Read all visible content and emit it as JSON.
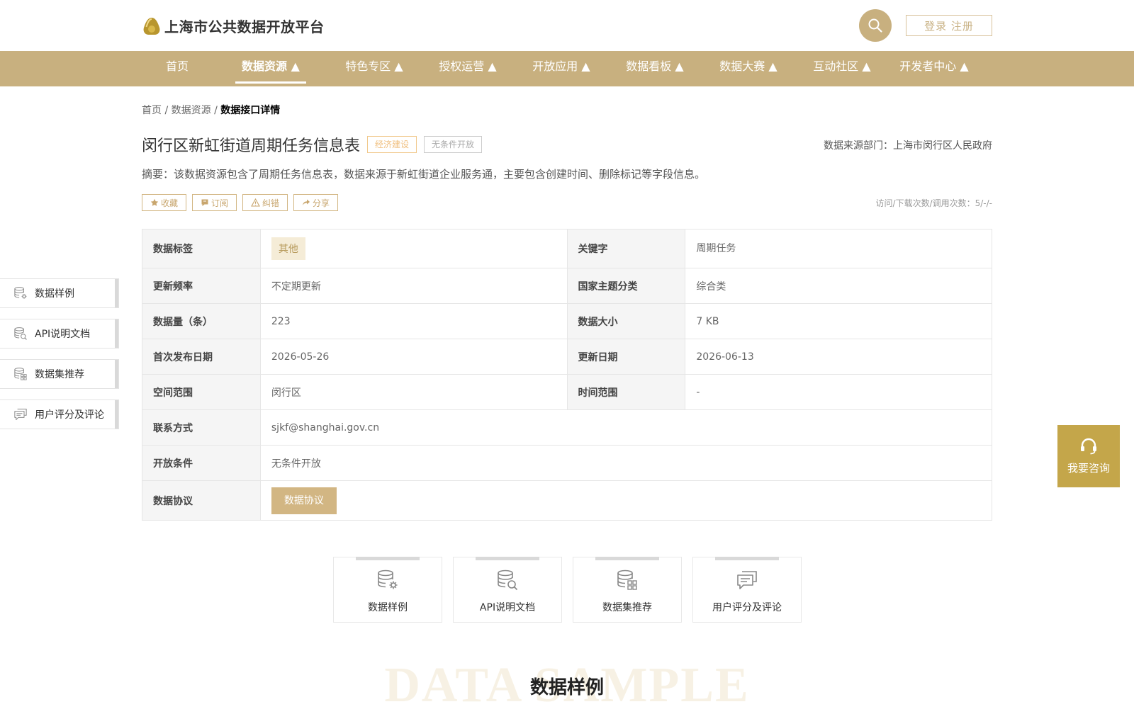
{
  "header": {
    "title": "上海市公共数据开放平台",
    "login_label": "登录 注册"
  },
  "nav": {
    "items": [
      {
        "label": "首页"
      },
      {
        "label": "数据资源 ▲"
      },
      {
        "label": "特色专区 ▲"
      },
      {
        "label": "授权运营 ▲"
      },
      {
        "label": "开放应用 ▲"
      },
      {
        "label": "数据看板 ▲"
      },
      {
        "label": "数据大赛 ▲"
      },
      {
        "label": "互动社区 ▲"
      },
      {
        "label": "开发者中心 ▲"
      }
    ],
    "active_index": 1
  },
  "breadcrumb": {
    "home": "首页",
    "sep": " / ",
    "resources": "数据资源",
    "current": "数据接口详情"
  },
  "detail": {
    "title": "闵行区新虹街道周期任务信息表",
    "tag_category": "经济建设",
    "tag_open": "无条件开放",
    "source": "数据来源部门：上海市闵行区人民政府",
    "summary": "摘要：该数据资源包含了周期任务信息表，数据来源于新虹街道企业服务通，主要包含创建时间、删除标记等字段信息。",
    "actions": {
      "collect": "收藏",
      "subscribe": "订阅",
      "report": "纠错",
      "share": "分享"
    },
    "stats": "访问/下载次数/调用次数：5/-/-"
  },
  "info": {
    "data_tag_label": "数据标签",
    "data_tag_value": "其他",
    "keyword_label": "关键字",
    "keyword_value": "周期任务",
    "freq_label": "更新频率",
    "freq_value": "不定期更新",
    "theme_label": "国家主题分类",
    "theme_value": "综合类",
    "count_label": "数据量（条）",
    "count_value": "223",
    "size_label": "数据大小",
    "size_value": "7 KB",
    "first_pub_label": "首次发布日期",
    "first_pub_value": "2026-05-26",
    "update_label": "更新日期",
    "update_value": "2026-06-13",
    "space_label": "空间范围",
    "space_value": "闵行区",
    "time_label": "时间范围",
    "time_value": "-",
    "contact_label": "联系方式",
    "contact_value": "sjkf@shanghai.gov.cn",
    "open_cond_label": "开放条件",
    "open_cond_value": "无条件开放",
    "protocol_label": "数据协议",
    "protocol_button": "数据协议"
  },
  "side_tabs": [
    {
      "label": "数据样例",
      "icon": "database-gear-icon"
    },
    {
      "label": "API说明文档",
      "icon": "database-search-icon"
    },
    {
      "label": "数据集推荐",
      "icon": "database-grid-icon"
    },
    {
      "label": "用户评分及评论",
      "icon": "comments-icon"
    }
  ],
  "consult": {
    "label": "我要咨询",
    "icon": "headset-icon"
  },
  "cards": [
    {
      "label": "数据样例",
      "icon": "database-gear-icon"
    },
    {
      "label": "API说明文档",
      "icon": "database-search-icon"
    },
    {
      "label": "数据集推荐",
      "icon": "database-grid-icon"
    },
    {
      "label": "用户评分及评论",
      "icon": "comments-icon"
    }
  ],
  "section": {
    "bg_word": "DATA SAMPLE",
    "title": "数据样例"
  },
  "colors": {
    "brand": "#c8b07f",
    "consult": "#c4a64a"
  }
}
